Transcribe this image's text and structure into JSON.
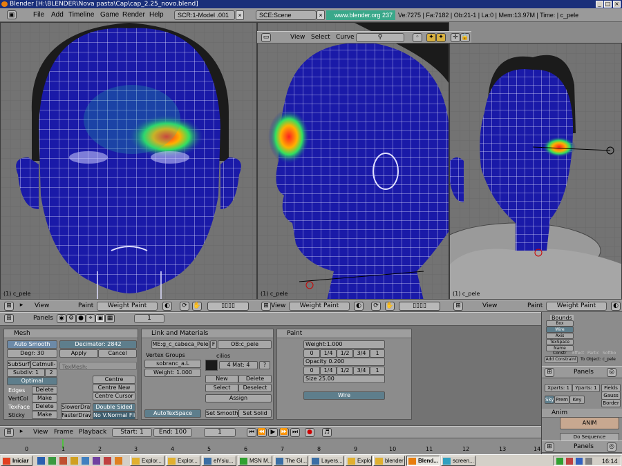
{
  "window": {
    "title": "Blender [H:\\BLENDER\\Nova pasta\\Cap\\cap_2.25_novo.blend]",
    "controls": [
      "_",
      "□",
      "×"
    ]
  },
  "menubar": {
    "items": [
      "File",
      "Add",
      "Timeline",
      "Game",
      "Render",
      "Help"
    ],
    "screen": "SCR:1-Model .001",
    "scene": "SCE:Scene",
    "website": "www.blender.org 237",
    "stats": "Ve:7275 | Fa:7182 | Ob:21-1 | La:0 | Mem:13.97M | Time: | c_pele"
  },
  "viewports": {
    "left_label": "(1) c_pele",
    "middle_label": "(1) c_pele",
    "right_label": "(1) c_pele"
  },
  "vp_header_top": {
    "view": "View",
    "select": "Select",
    "curve": "Curve"
  },
  "vp_header_bottom": {
    "view": "View",
    "paint": "Paint",
    "mode": "Weight Paint"
  },
  "buttons_header": {
    "panels": "Panels",
    "frame": "1"
  },
  "mesh_panel": {
    "title": "Mesh",
    "auto_smooth": "Auto Smooth",
    "degr": "Degr: 30",
    "decimator": "Decimator: 2842",
    "apply": "Apply",
    "cancel": "Cancel",
    "subsurf": "SubSurf",
    "catmull": "Catmull-",
    "subdiv": "Subdiv: 1",
    "subdiv_r": "2",
    "texmesh": "TexMesh:",
    "optimal": "Optimal",
    "centre": "Centre",
    "centre_new": "Centre New",
    "centre_cursor": "Centre Cursor",
    "edges": "Edges",
    "vertcol": "VertCol",
    "texface": "TexFace",
    "sticky": "Sticky",
    "delete": "Delete",
    "make": "Make",
    "slower_draw": "SlowerDraw",
    "faster_draw": "FasterDraw",
    "double_sided": "Double Sided",
    "no_vnormal_flip": "No V.Normal Flip"
  },
  "link_panel": {
    "title": "Link and Materials",
    "me": "ME:g_c_cabeca_Pele",
    "f": "F",
    "ob": "OB:c_pele",
    "vertex_groups": "Vertex Groups",
    "group": "sobranc_a.L",
    "weight": "Weight: 1.000",
    "cilios": "cilios",
    "mat": "4 Mat: 4",
    "q": "?",
    "new": "New",
    "delete": "Delete",
    "select": "Select",
    "deselect": "Deselect",
    "assign": "Assign",
    "autotexspace": "AutoTexSpace",
    "set_smooth": "Set Smooth",
    "set_solid": "Set Solid"
  },
  "paint_panel": {
    "title": "Paint",
    "weight": "Weight:1.000",
    "opacity": "Opacity 0.200",
    "size": "Size 25.00",
    "presets1": [
      "0",
      "1/4",
      "1/2",
      "3/4",
      "1"
    ],
    "presets2": [
      "0",
      "1/4",
      "1/2",
      "3/4",
      "1"
    ],
    "wire": "Wire"
  },
  "timeline": {
    "view": "View",
    "frame": "Frame",
    "playback": "Playback",
    "start": "Start: 1",
    "end": "End: 100",
    "current": "1",
    "ticks": [
      "0",
      "1",
      "2",
      "3",
      "4",
      "5",
      "6",
      "7",
      "8",
      "9",
      "10",
      "11",
      "12",
      "13",
      "14"
    ]
  },
  "rightpanel": {
    "bounds": "Bounds",
    "box": "Box",
    "wire": "Wire",
    "axis": "Axis",
    "texspace": "TexSpace",
    "name": "Name",
    "constr": "Constr",
    "effect": "Effect",
    "partic": "Partic",
    "softbo": "Softbo",
    "add_constraint": "Add Constraint",
    "to_object": "To Object: c_pele",
    "panels": "Panels",
    "xparts": "Xparts: 1",
    "yparts": "Yparts: 1",
    "fields": "Fields",
    "gauss": "Gauss",
    "border": "Border",
    "sky": "Sky",
    "prem": "Prem",
    "key": "Key",
    "anim_title": "Anim",
    "anim": "ANIM",
    "do_sequence": "Do Sequence",
    "panels2": "Panels"
  },
  "taskbar": {
    "start": "Iniciar",
    "clock": "16:14",
    "tasks": [
      "Explor...",
      "Explor...",
      "elYsiu...",
      "MSN M...",
      "The GI...",
      "Layers...",
      "Explor...",
      "blender",
      "Blend...",
      "screen..."
    ]
  }
}
